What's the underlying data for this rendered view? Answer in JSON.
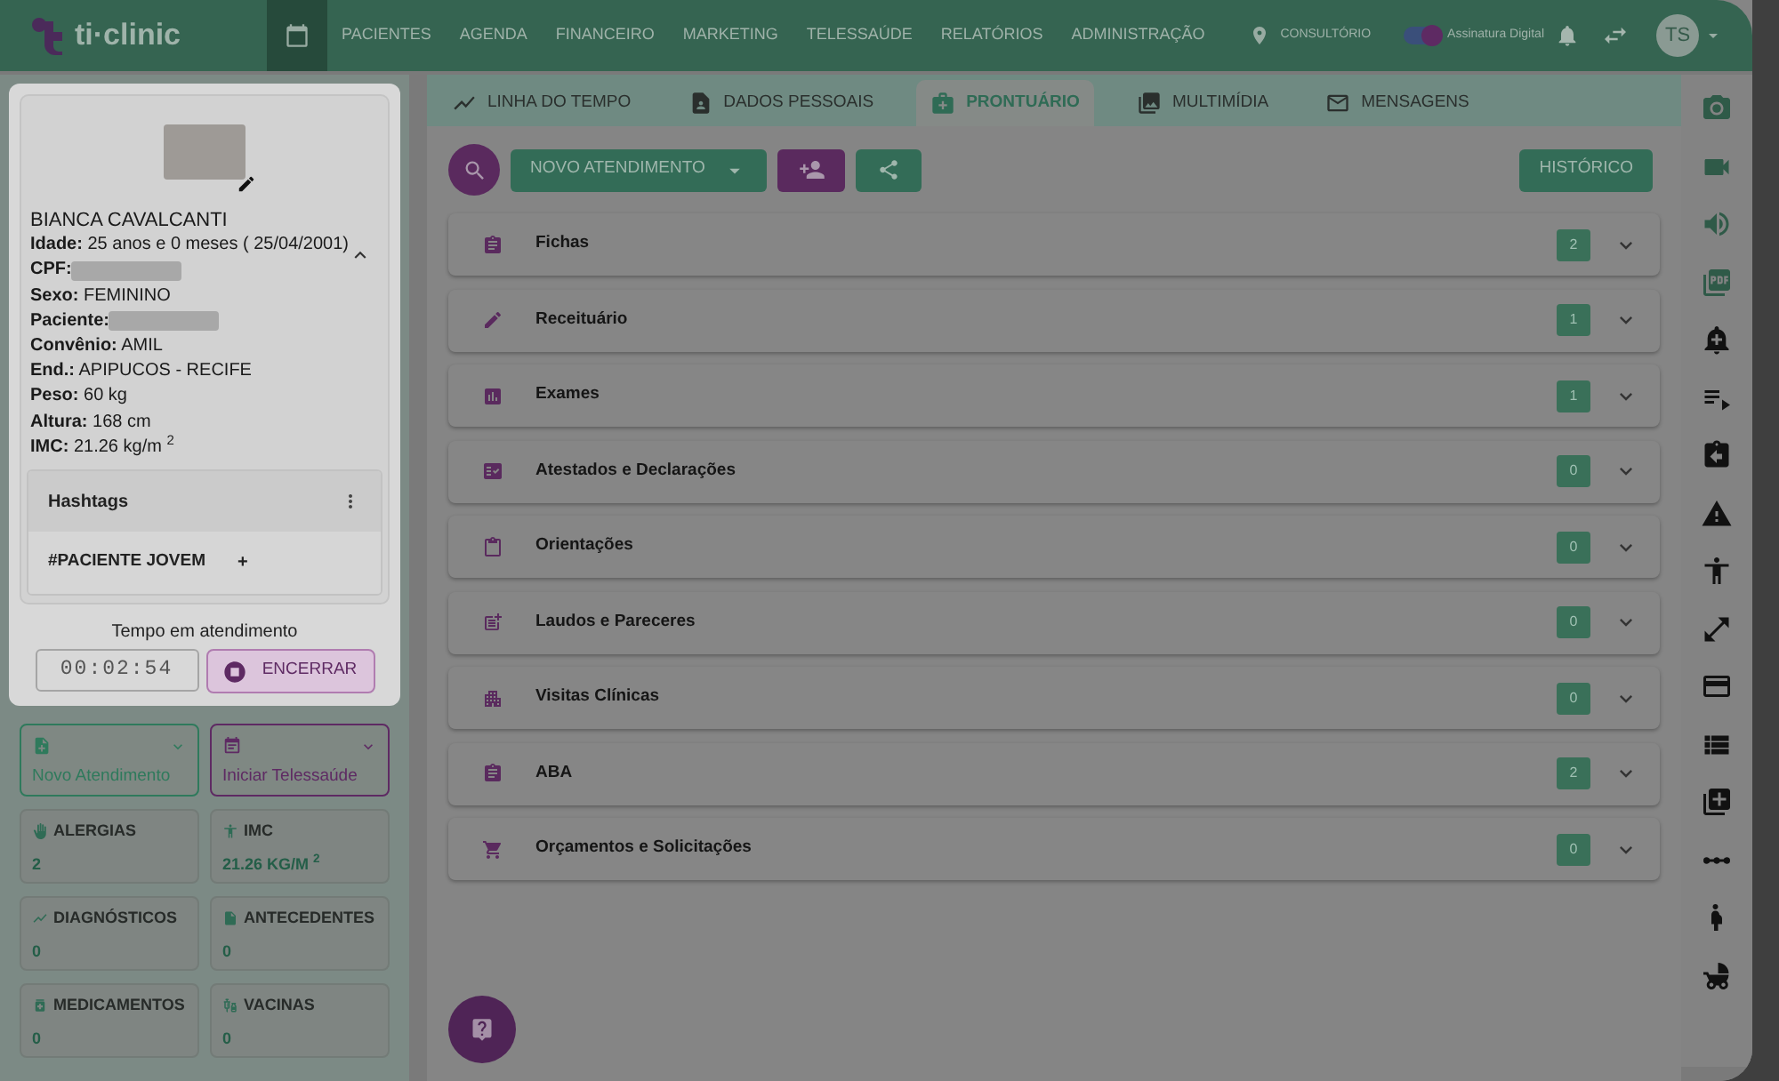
{
  "header": {
    "logo": "ti·clinic",
    "nav": [
      {
        "kind": "icon",
        "selected": true
      },
      {
        "kind": "text",
        "label": "PACIENTES",
        "selected": false
      },
      {
        "kind": "text",
        "label": "AGENDA",
        "selected": false
      },
      {
        "kind": "text",
        "label": "FINANCEIRO",
        "selected": false
      },
      {
        "kind": "text",
        "label": "MARKETING",
        "selected": false
      },
      {
        "kind": "text",
        "label": "TELESSAÚDE",
        "selected": false
      },
      {
        "kind": "text",
        "label": "RELATÓRIOS",
        "selected": false
      },
      {
        "kind": "text",
        "label": "ADMINISTRAÇÃO",
        "selected": false
      }
    ],
    "location": "CONSULTÓRIO",
    "signature": {
      "label": "Assinatura Digital",
      "on": true
    },
    "avatar": "TS"
  },
  "patient": {
    "name": "BIANCA CAVALCANTI",
    "expanded": true,
    "fields": [
      {
        "label": "Idade:",
        "value": "25 anos e 0 meses ( 25/04/2001)",
        "redacted": false
      },
      {
        "label": "CPF:",
        "redacted": true
      },
      {
        "label": "Sexo:",
        "value": "FEMININO",
        "redacted": false
      },
      {
        "label": "Paciente:",
        "redacted": true
      },
      {
        "label": "Convênio:",
        "value": "AMIL",
        "redacted": false
      },
      {
        "label": "End.:",
        "value": "APIPUCOS -  RECIFE",
        "redacted": false
      },
      {
        "label": "Peso:",
        "value": "60 kg",
        "redacted": false
      },
      {
        "label": "Altura:",
        "value": "168 cm",
        "redacted": false
      },
      {
        "label": "IMC:",
        "value": "21.26 kg/m $^{2}$",
        "redacted": false
      }
    ],
    "hashtags": {
      "title": "Hashtags",
      "tags": [
        "#PACIENTE JOVEM"
      ],
      "add": "+"
    },
    "timer": {
      "label": "Tempo em atendimento",
      "time": "00:02:54",
      "stop": "ENCERRAR"
    }
  },
  "quick_actions": [
    {
      "label": "Novo Atendimento",
      "color": "#2f7a5c"
    },
    {
      "label": "Iniciar Telessaúde",
      "color": "#5e2a63"
    }
  ],
  "tiles": [
    {
      "label": "ALERGIAS",
      "value": "2"
    },
    {
      "label": "IMC",
      "value": "21.26 KG/M $^{2}$"
    },
    {
      "label": "DIAGNÓSTICOS",
      "value": "0"
    },
    {
      "label": "ANTECEDENTES",
      "value": "0"
    },
    {
      "label": "MEDICAMENTOS",
      "value": "0"
    },
    {
      "label": "VACINAS",
      "value": "0"
    }
  ],
  "tabs": [
    {
      "label": "LINHA DO TEMPO",
      "selected": false
    },
    {
      "label": "DADOS PESSOAIS",
      "selected": false
    },
    {
      "label": "PRONTUÁRIO",
      "selected": true
    },
    {
      "label": "MULTIMÍDIA",
      "selected": false
    },
    {
      "label": "MENSAGENS",
      "selected": false
    }
  ],
  "toolbar": {
    "new_button": "NOVO ATENDIMENTO",
    "history_button": "HISTÓRICO"
  },
  "sections": [
    {
      "title": "Fichas",
      "count": "2"
    },
    {
      "title": "Receituário",
      "count": "1"
    },
    {
      "title": "Exames",
      "count": "1"
    },
    {
      "title": "Atestados e Declarações",
      "count": "0"
    },
    {
      "title": "Orientações",
      "count": "0"
    },
    {
      "title": "Laudos e Pareceres",
      "count": "0"
    },
    {
      "title": "Visitas Clínicas",
      "count": "0"
    },
    {
      "title": "ABA",
      "count": "2"
    },
    {
      "title": "Orçamentos e Solicitações",
      "count": "0"
    }
  ]
}
